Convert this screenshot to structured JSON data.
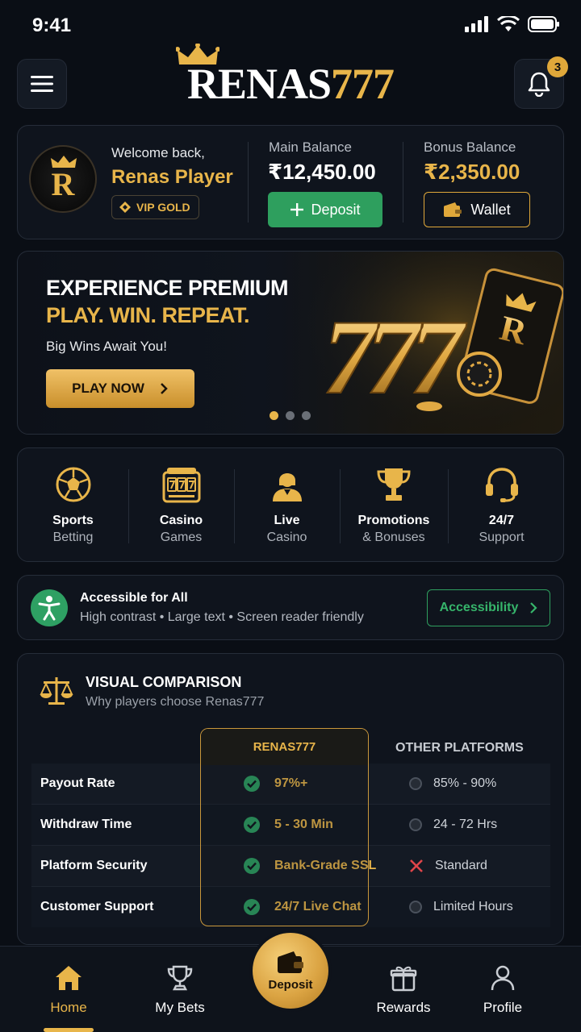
{
  "status": {
    "time": "9:41"
  },
  "header": {
    "logo_white": "RENAS",
    "logo_gold": "777",
    "notification_count": "3"
  },
  "account": {
    "welcome": "Welcome back,",
    "name": "Renas Player",
    "vip": "VIP GOLD",
    "avatar_letter": "R",
    "main_balance_label": "Main Balance",
    "main_balance": "₹12,450.00",
    "bonus_balance_label": "Bonus Balance",
    "bonus_balance": "₹2,350.00",
    "deposit_label": "Deposit",
    "wallet_label": "Wallet"
  },
  "banner": {
    "headline": "EXPERIENCE PREMIUM",
    "tagline": "PLAY. WIN. REPEAT.",
    "subtitle": "Big Wins Await You!",
    "cta": "PLAY NOW",
    "art_text": "777",
    "card_letter": "R",
    "slide_count": 3,
    "active_slide": 1
  },
  "categories": [
    {
      "line1": "Sports",
      "line2": "Betting",
      "icon": "soccer-ball-icon"
    },
    {
      "line1": "Casino",
      "line2": "Games",
      "icon": "slot-machine-icon"
    },
    {
      "line1": "Live",
      "line2": "Casino",
      "icon": "dealer-icon"
    },
    {
      "line1": "Promotions",
      "line2": "& Bonuses",
      "icon": "trophy-icon"
    },
    {
      "line1": "24/7",
      "line2": "Support",
      "icon": "headset-icon"
    }
  ],
  "accessibility": {
    "title": "Accessible for All",
    "subtitle": "High contrast • Large text • Screen reader friendly",
    "button": "Accessibility"
  },
  "comparison": {
    "title": "VISUAL COMPARISON",
    "subtitle": "Why players choose Renas777",
    "col_renas": "RENAS777",
    "col_other": "OTHER PLATFORMS",
    "rows": [
      {
        "label": "Payout Rate",
        "renas": "97%+",
        "other": "85% - 90%",
        "other_status": "neutral"
      },
      {
        "label": "Withdraw Time",
        "renas": "5 - 30 Min",
        "other": "24 - 72 Hrs",
        "other_status": "neutral"
      },
      {
        "label": "Platform Security",
        "renas": "Bank-Grade SSL",
        "other": "Standard",
        "other_status": "negative"
      },
      {
        "label": "Customer Support",
        "renas": "24/7 Live Chat",
        "other": "Limited Hours",
        "other_status": "neutral"
      }
    ]
  },
  "nav": {
    "home": "Home",
    "bets": "My Bets",
    "deposit": "Deposit",
    "rewards": "Rewards",
    "profile": "Profile",
    "active": "home"
  },
  "colors": {
    "gold": "#e8b54a",
    "green": "#2ea063",
    "background": "#0a0e15",
    "card": "#0f141d"
  }
}
